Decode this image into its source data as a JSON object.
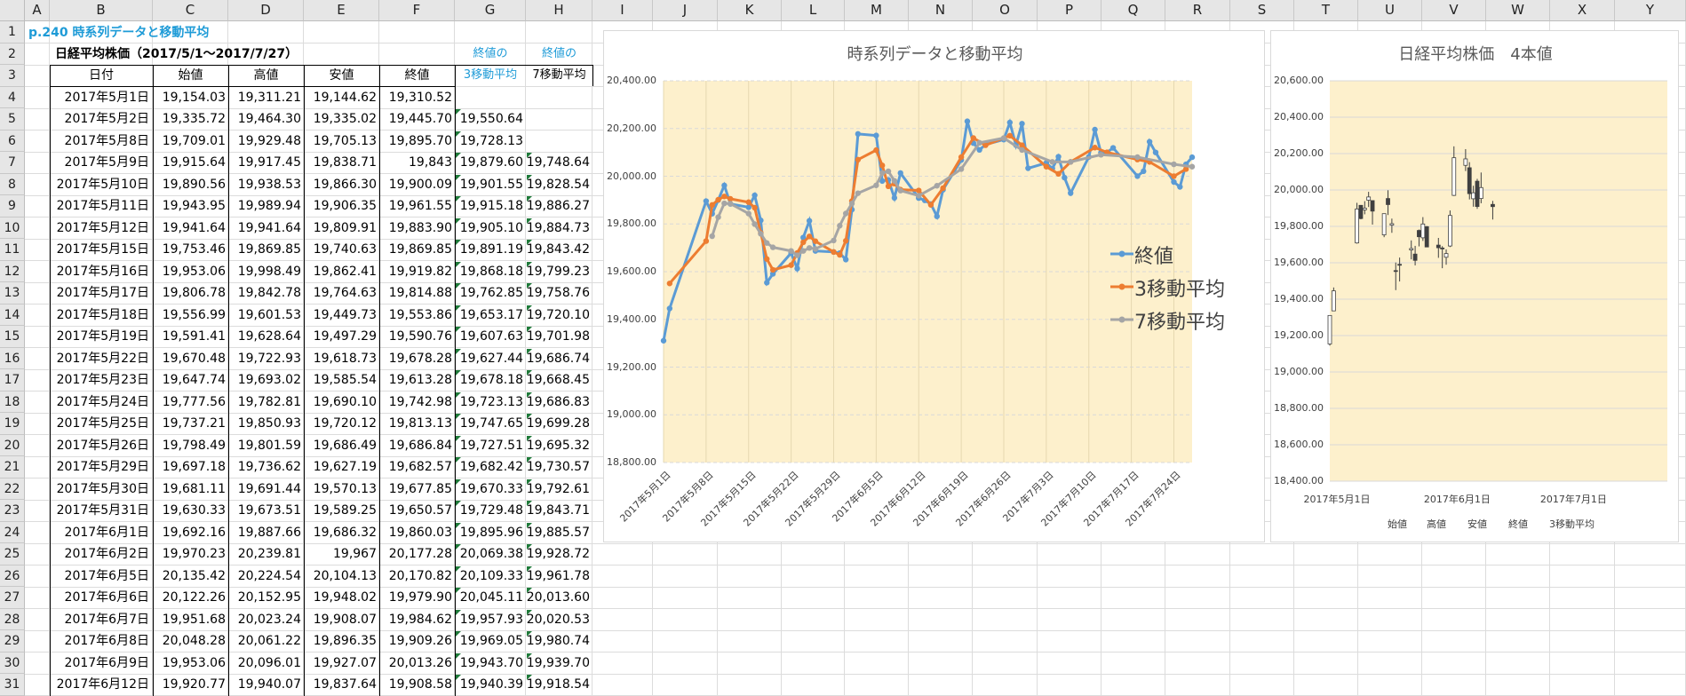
{
  "columns": [
    "A",
    "B",
    "C",
    "D",
    "E",
    "F",
    "G",
    "H",
    "I",
    "J",
    "K",
    "L",
    "M",
    "N",
    "O",
    "P",
    "Q",
    "R",
    "S",
    "T",
    "U",
    "V",
    "W",
    "X",
    "Y"
  ],
  "rows": [
    "1",
    "2",
    "3",
    "4",
    "5",
    "6",
    "7",
    "8",
    "9",
    "10",
    "11",
    "12",
    "13",
    "14",
    "15",
    "16",
    "17",
    "18",
    "19",
    "20",
    "21",
    "22",
    "23",
    "24",
    "25",
    "26",
    "27",
    "28",
    "29",
    "30",
    "31"
  ],
  "title_cell": "p.240 時系列データと移動平均",
  "subtitle_cell": "日経平均株価（2017/5/1～2017/7/27）",
  "g2": "終値の",
  "h2": "終値の",
  "headers": [
    "日付",
    "始値",
    "高値",
    "安値",
    "終値",
    "3移動平均",
    "7移動平均"
  ],
  "table": [
    [
      "2017年5月1日",
      "19,154.03",
      "19,311.21",
      "19,144.62",
      "19,310.52",
      "",
      ""
    ],
    [
      "2017年5月2日",
      "19,335.72",
      "19,464.30",
      "19,335.02",
      "19,445.70",
      "19,550.64",
      ""
    ],
    [
      "2017年5月8日",
      "19,709.01",
      "19,929.48",
      "19,705.13",
      "19,895.70",
      "19,728.13",
      ""
    ],
    [
      "2017年5月9日",
      "19,915.64",
      "19,917.45",
      "19,838.71",
      "19,843",
      "19,879.60",
      "19,748.64"
    ],
    [
      "2017年5月10日",
      "19,890.56",
      "19,938.53",
      "19,866.30",
      "19,900.09",
      "19,901.55",
      "19,828.54"
    ],
    [
      "2017年5月11日",
      "19,943.95",
      "19,989.94",
      "19,906.35",
      "19,961.55",
      "19,915.18",
      "19,886.27"
    ],
    [
      "2017年5月12日",
      "19,941.64",
      "19,941.64",
      "19,809.91",
      "19,883.90",
      "19,905.10",
      "19,884.73"
    ],
    [
      "2017年5月15日",
      "19,753.46",
      "19,869.85",
      "19,740.63",
      "19,869.85",
      "19,891.19",
      "19,843.42"
    ],
    [
      "2017年5月16日",
      "19,953.06",
      "19,998.49",
      "19,862.41",
      "19,919.82",
      "19,868.18",
      "19,799.23"
    ],
    [
      "2017年5月17日",
      "19,806.78",
      "19,842.78",
      "19,764.63",
      "19,814.88",
      "19,762.85",
      "19,758.76"
    ],
    [
      "2017年5月18日",
      "19,556.99",
      "19,601.53",
      "19,449.73",
      "19,553.86",
      "19,653.17",
      "19,720.10"
    ],
    [
      "2017年5月19日",
      "19,591.41",
      "19,628.64",
      "19,497.29",
      "19,590.76",
      "19,607.63",
      "19,701.98"
    ],
    [
      "2017年5月22日",
      "19,670.48",
      "19,722.93",
      "19,618.73",
      "19,678.28",
      "19,627.44",
      "19,686.74"
    ],
    [
      "2017年5月23日",
      "19,647.74",
      "19,693.02",
      "19,585.54",
      "19,613.28",
      "19,678.18",
      "19,668.45"
    ],
    [
      "2017年5月24日",
      "19,777.56",
      "19,782.81",
      "19,690.10",
      "19,742.98",
      "19,723.13",
      "19,686.83"
    ],
    [
      "2017年5月25日",
      "19,737.21",
      "19,850.93",
      "19,720.12",
      "19,813.13",
      "19,747.65",
      "19,699.28"
    ],
    [
      "2017年5月26日",
      "19,798.49",
      "19,801.59",
      "19,686.49",
      "19,686.84",
      "19,727.51",
      "19,695.32"
    ],
    [
      "2017年5月29日",
      "19,697.18",
      "19,736.62",
      "19,627.19",
      "19,682.57",
      "19,682.42",
      "19,730.57"
    ],
    [
      "2017年5月30日",
      "19,681.11",
      "19,691.44",
      "19,570.13",
      "19,677.85",
      "19,670.33",
      "19,792.61"
    ],
    [
      "2017年5月31日",
      "19,630.33",
      "19,673.51",
      "19,589.25",
      "19,650.57",
      "19,729.48",
      "19,843.71"
    ],
    [
      "2017年6月1日",
      "19,692.16",
      "19,887.66",
      "19,686.32",
      "19,860.03",
      "19,895.96",
      "19,885.57"
    ],
    [
      "2017年6月2日",
      "19,970.23",
      "20,239.81",
      "19,967",
      "20,177.28",
      "20,069.38",
      "19,928.72"
    ],
    [
      "2017年6月5日",
      "20,135.42",
      "20,224.54",
      "20,104.13",
      "20,170.82",
      "20,109.33",
      "19,961.78"
    ],
    [
      "2017年6月6日",
      "20,122.26",
      "20,152.95",
      "19,948.02",
      "19,979.90",
      "20,045.11",
      "20,013.60"
    ],
    [
      "2017年6月7日",
      "19,951.68",
      "20,023.24",
      "19,908.07",
      "19,984.62",
      "19,957.93",
      "20,020.53"
    ],
    [
      "2017年6月8日",
      "20,048.28",
      "20,061.22",
      "19,896.35",
      "19,909.26",
      "19,969.05",
      "19,980.74"
    ],
    [
      "2017年6月9日",
      "19,953.06",
      "20,096.01",
      "19,927.07",
      "20,013.26",
      "19,943.70",
      "19,939.70"
    ],
    [
      "2017年6月12日",
      "19,920.77",
      "19,940.07",
      "19,837.64",
      "19,908.58",
      "19,940.39",
      "19,918.54"
    ]
  ],
  "chart1": {
    "title": "時系列データと移動平均",
    "yticks": [
      "20,400.00",
      "20,200.00",
      "20,000.00",
      "19,800.00",
      "19,600.00",
      "19,400.00",
      "19,200.00",
      "19,000.00",
      "18,800.00"
    ],
    "xticks": [
      "2017年5月1日",
      "2017年5月8日",
      "2017年5月15日",
      "2017年5月22日",
      "2017年5月29日",
      "2017年6月5日",
      "2017年6月12日",
      "2017年6月19日",
      "2017年6月26日",
      "2017年7月3日",
      "2017年7月10日",
      "2017年7月17日",
      "2017年7月24日"
    ],
    "legend": [
      "終値",
      "3移動平均",
      "7移動平均"
    ],
    "colors": [
      "#5b9bd5",
      "#ed7d31",
      "#a5a5a5"
    ]
  },
  "chart2": {
    "title": "日経平均株価　4本値",
    "yticks": [
      "20,600.00",
      "20,400.00",
      "20,200.00",
      "20,000.00",
      "19,800.00",
      "19,600.00",
      "19,400.00",
      "19,200.00",
      "19,000.00",
      "18,800.00",
      "18,600.00",
      "18,400.00"
    ],
    "xticks": [
      "2017年5月1日",
      "2017年6月1日",
      "2017年7月1日"
    ],
    "legend": [
      "始値",
      "高値",
      "安値",
      "終値",
      "3移動平均"
    ]
  },
  "chart_data": [
    {
      "type": "line",
      "title": "時系列データと移動平均",
      "ylim": [
        18800,
        20400
      ],
      "xlim": [
        "2017-05-01",
        "2017-07-27"
      ],
      "legend": "right",
      "series": [
        {
          "name": "終値",
          "x": [
            "2017-05-01",
            "2017-05-02",
            "2017-05-08",
            "2017-05-09",
            "2017-05-10",
            "2017-05-11",
            "2017-05-12",
            "2017-05-15",
            "2017-05-16",
            "2017-05-17",
            "2017-05-18",
            "2017-05-19",
            "2017-05-22",
            "2017-05-23",
            "2017-05-24",
            "2017-05-25",
            "2017-05-26",
            "2017-05-29",
            "2017-05-30",
            "2017-05-31",
            "2017-06-01",
            "2017-06-02",
            "2017-06-05",
            "2017-06-06",
            "2017-06-07",
            "2017-06-08",
            "2017-06-09",
            "2017-06-12",
            "2017-06-13",
            "2017-06-14",
            "2017-06-15",
            "2017-06-16",
            "2017-06-19",
            "2017-06-20",
            "2017-06-21",
            "2017-06-22",
            "2017-06-23",
            "2017-06-26",
            "2017-06-27",
            "2017-06-28",
            "2017-06-29",
            "2017-06-30",
            "2017-07-03",
            "2017-07-04",
            "2017-07-05",
            "2017-07-06",
            "2017-07-07",
            "2017-07-10",
            "2017-07-11",
            "2017-07-12",
            "2017-07-13",
            "2017-07-14",
            "2017-07-18",
            "2017-07-19",
            "2017-07-20",
            "2017-07-21",
            "2017-07-24",
            "2017-07-25",
            "2017-07-26",
            "2017-07-27"
          ],
          "y": [
            19310.52,
            19445.7,
            19895.7,
            19843,
            19900.09,
            19961.55,
            19883.9,
            19869.85,
            19919.82,
            19814.88,
            19553.86,
            19590.76,
            19678.28,
            19613.28,
            19742.98,
            19813.13,
            19686.84,
            19682.57,
            19677.85,
            19650.57,
            19860.03,
            20177.28,
            20170.82,
            19979.9,
            19984.62,
            19909.26,
            20013.26,
            19908.58,
            19898.75,
            19883.44,
            19831.82,
            19943.26,
            20067.75,
            20230.41,
            20138.79,
            20110.51,
            20132.67,
            20153.35,
            20225.09,
            20130.41,
            20220.3,
            20033.43,
            20055.8,
            20032.35,
            20081.63,
            19994.06,
            19929.09,
            20080.98,
            20195.48,
            20098.38,
            20099.81,
            20118.86,
            20000.36,
            20020.86,
            20144.59,
            20099.75,
            19975.67,
            19955.2,
            20050.16,
            20079.64
          ]
        },
        {
          "name": "3移動平均",
          "x": [
            "2017-05-02",
            "2017-05-08",
            "2017-05-09",
            "2017-05-10",
            "2017-05-11",
            "2017-05-12",
            "2017-05-15",
            "2017-05-16",
            "2017-05-17",
            "2017-05-18",
            "2017-05-19",
            "2017-05-22",
            "2017-05-23",
            "2017-05-24",
            "2017-05-25",
            "2017-05-26",
            "2017-05-29",
            "2017-05-30",
            "2017-05-31",
            "2017-06-01",
            "2017-06-02",
            "2017-06-05",
            "2017-06-06",
            "2017-06-07",
            "2017-06-08",
            "2017-06-09",
            "2017-06-12",
            "2017-06-14",
            "2017-06-16",
            "2017-06-19",
            "2017-06-21",
            "2017-06-23",
            "2017-06-27",
            "2017-06-29",
            "2017-07-03",
            "2017-07-05",
            "2017-07-07",
            "2017-07-11",
            "2017-07-13",
            "2017-07-18",
            "2017-07-20",
            "2017-07-24",
            "2017-07-26"
          ],
          "y": [
            19550.64,
            19728.13,
            19879.6,
            19901.55,
            19915.18,
            19905.1,
            19891.19,
            19868.18,
            19762.85,
            19653.17,
            19607.63,
            19627.44,
            19678.18,
            19723.13,
            19747.65,
            19727.51,
            19682.42,
            19670.33,
            19729.48,
            19895.96,
            20069.38,
            20109.33,
            20045.11,
            19957.93,
            19969.05,
            19943.7,
            19940.39,
            19880,
            19950,
            20080,
            20160,
            20130,
            20170,
            20130,
            20040,
            20010,
            20060,
            20120,
            20100,
            20070,
            20060,
            20000,
            20030
          ]
        },
        {
          "name": "7移動平均",
          "x": [
            "2017-05-09",
            "2017-05-10",
            "2017-05-11",
            "2017-05-12",
            "2017-05-15",
            "2017-05-16",
            "2017-05-17",
            "2017-05-18",
            "2017-05-19",
            "2017-05-22",
            "2017-05-23",
            "2017-05-24",
            "2017-05-25",
            "2017-05-26",
            "2017-05-29",
            "2017-05-30",
            "2017-05-31",
            "2017-06-01",
            "2017-06-02",
            "2017-06-05",
            "2017-06-06",
            "2017-06-07",
            "2017-06-08",
            "2017-06-09",
            "2017-06-12",
            "2017-06-15",
            "2017-06-19",
            "2017-06-22",
            "2017-06-26",
            "2017-06-29",
            "2017-07-04",
            "2017-07-07",
            "2017-07-12",
            "2017-07-18",
            "2017-07-24",
            "2017-07-27"
          ],
          "y": [
            19748.64,
            19828.54,
            19886.27,
            19884.73,
            19843.42,
            19799.23,
            19758.76,
            19720.1,
            19701.98,
            19686.74,
            19668.45,
            19686.83,
            19699.28,
            19695.32,
            19730.57,
            19792.61,
            19843.71,
            19885.57,
            19928.72,
            19961.78,
            20013.6,
            20020.53,
            19980.74,
            19939.7,
            19918.54,
            19960,
            20030,
            20140,
            20160,
            20110,
            20060,
            20060,
            20090,
            20080,
            20050,
            20040
          ]
        }
      ]
    },
    {
      "type": "candlestick",
      "title": "日経平均株価　4本値",
      "ylim": [
        18400,
        20600
      ],
      "xlim": [
        "2017-05-01",
        "2017-07-27"
      ],
      "legend": "bottom",
      "series": [
        {
          "name": "4本値",
          "x": [
            "2017-05-01",
            "2017-05-02",
            "2017-05-08",
            "2017-05-09",
            "2017-05-10",
            "2017-05-11",
            "2017-05-12",
            "2017-05-15",
            "2017-05-16",
            "2017-05-17",
            "2017-05-18",
            "2017-05-19",
            "2017-05-22",
            "2017-05-23",
            "2017-05-24",
            "2017-05-25",
            "2017-05-26",
            "2017-05-29",
            "2017-05-30",
            "2017-05-31",
            "2017-06-01",
            "2017-06-02",
            "2017-06-05",
            "2017-06-06",
            "2017-06-07",
            "2017-06-08",
            "2017-06-09",
            "2017-06-12"
          ],
          "open": [
            19154.03,
            19335.72,
            19709.01,
            19915.64,
            19890.56,
            19943.95,
            19941.64,
            19753.46,
            19953.06,
            19806.78,
            19556.99,
            19591.41,
            19670.48,
            19647.74,
            19777.56,
            19737.21,
            19798.49,
            19697.18,
            19681.11,
            19630.33,
            19692.16,
            19970.23,
            20135.42,
            20122.26,
            19951.68,
            20048.28,
            19953.06,
            19920.77
          ],
          "high": [
            19311.21,
            19464.3,
            19929.48,
            19917.45,
            19938.53,
            19989.94,
            19941.64,
            19869.85,
            19998.49,
            19842.78,
            19601.53,
            19628.64,
            19722.93,
            19693.02,
            19782.81,
            19850.93,
            19801.59,
            19736.62,
            19691.44,
            19673.51,
            19887.66,
            20239.81,
            20224.54,
            20152.95,
            20023.24,
            20061.22,
            20096.01,
            19940.07
          ],
          "low": [
            19144.62,
            19335.02,
            19705.13,
            19838.71,
            19866.3,
            19906.35,
            19809.91,
            19740.63,
            19862.41,
            19764.63,
            19449.73,
            19497.29,
            19618.73,
            19585.54,
            19690.1,
            19720.12,
            19686.49,
            19627.19,
            19570.13,
            19589.25,
            19686.32,
            19967,
            20104.13,
            19948.02,
            19908.07,
            19896.35,
            19927.07,
            19837.64
          ],
          "close": [
            19310.52,
            19445.7,
            19895.7,
            19843,
            19900.09,
            19961.55,
            19883.9,
            19869.85,
            19919.82,
            19814.88,
            19553.86,
            19590.76,
            19678.28,
            19613.28,
            19742.98,
            19813.13,
            19686.84,
            19682.57,
            19677.85,
            19650.57,
            19860.03,
            20177.28,
            20170.82,
            19979.9,
            19984.62,
            19909.26,
            20013.26,
            19908.58
          ]
        }
      ]
    }
  ]
}
